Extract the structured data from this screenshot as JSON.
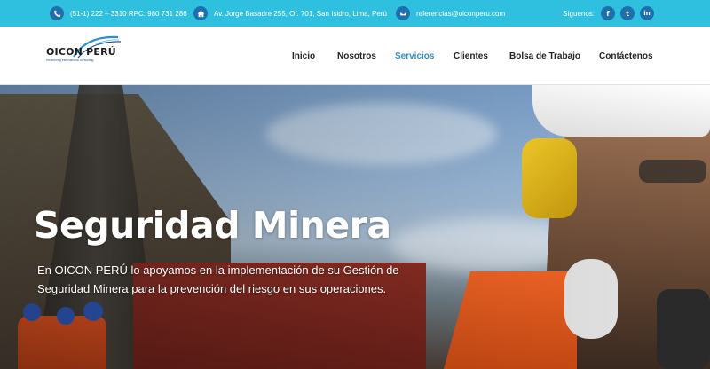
{
  "topbar": {
    "phone": "(51-1) 222 – 3310 RPC: 980 731 286",
    "address": "Av. Jorge Basadre 255, Of. 701, San Isidro, Lima, Perú",
    "email": "referencias@oiconperu.com",
    "follow_label": "Síguenos:",
    "social": [
      {
        "icon": "facebook-icon",
        "glyph": "f"
      },
      {
        "icon": "twitter-icon",
        "glyph": "t"
      },
      {
        "icon": "linkedin-icon",
        "glyph": "in"
      }
    ]
  },
  "header": {
    "logo_text": "OICON PERÚ",
    "logo_subtext": "Redefining international consulting",
    "nav": [
      "Inicio",
      "Nosotros",
      "Servicios",
      "Clientes",
      "Bolsa de Trabajo",
      "Contáctenos"
    ],
    "active_nav": "Servicios"
  },
  "hero": {
    "title": "Seguridad Minera",
    "text": "En OICON PERÚ lo apoyamos en la implementación de su Gestión de Seguridad Minera para la prevención del riesgo en sus operaciones."
  },
  "colors": {
    "topbar": "#2ec0de",
    "icon_circle": "#1d6fae",
    "nav_active": "#2b8fd4"
  }
}
